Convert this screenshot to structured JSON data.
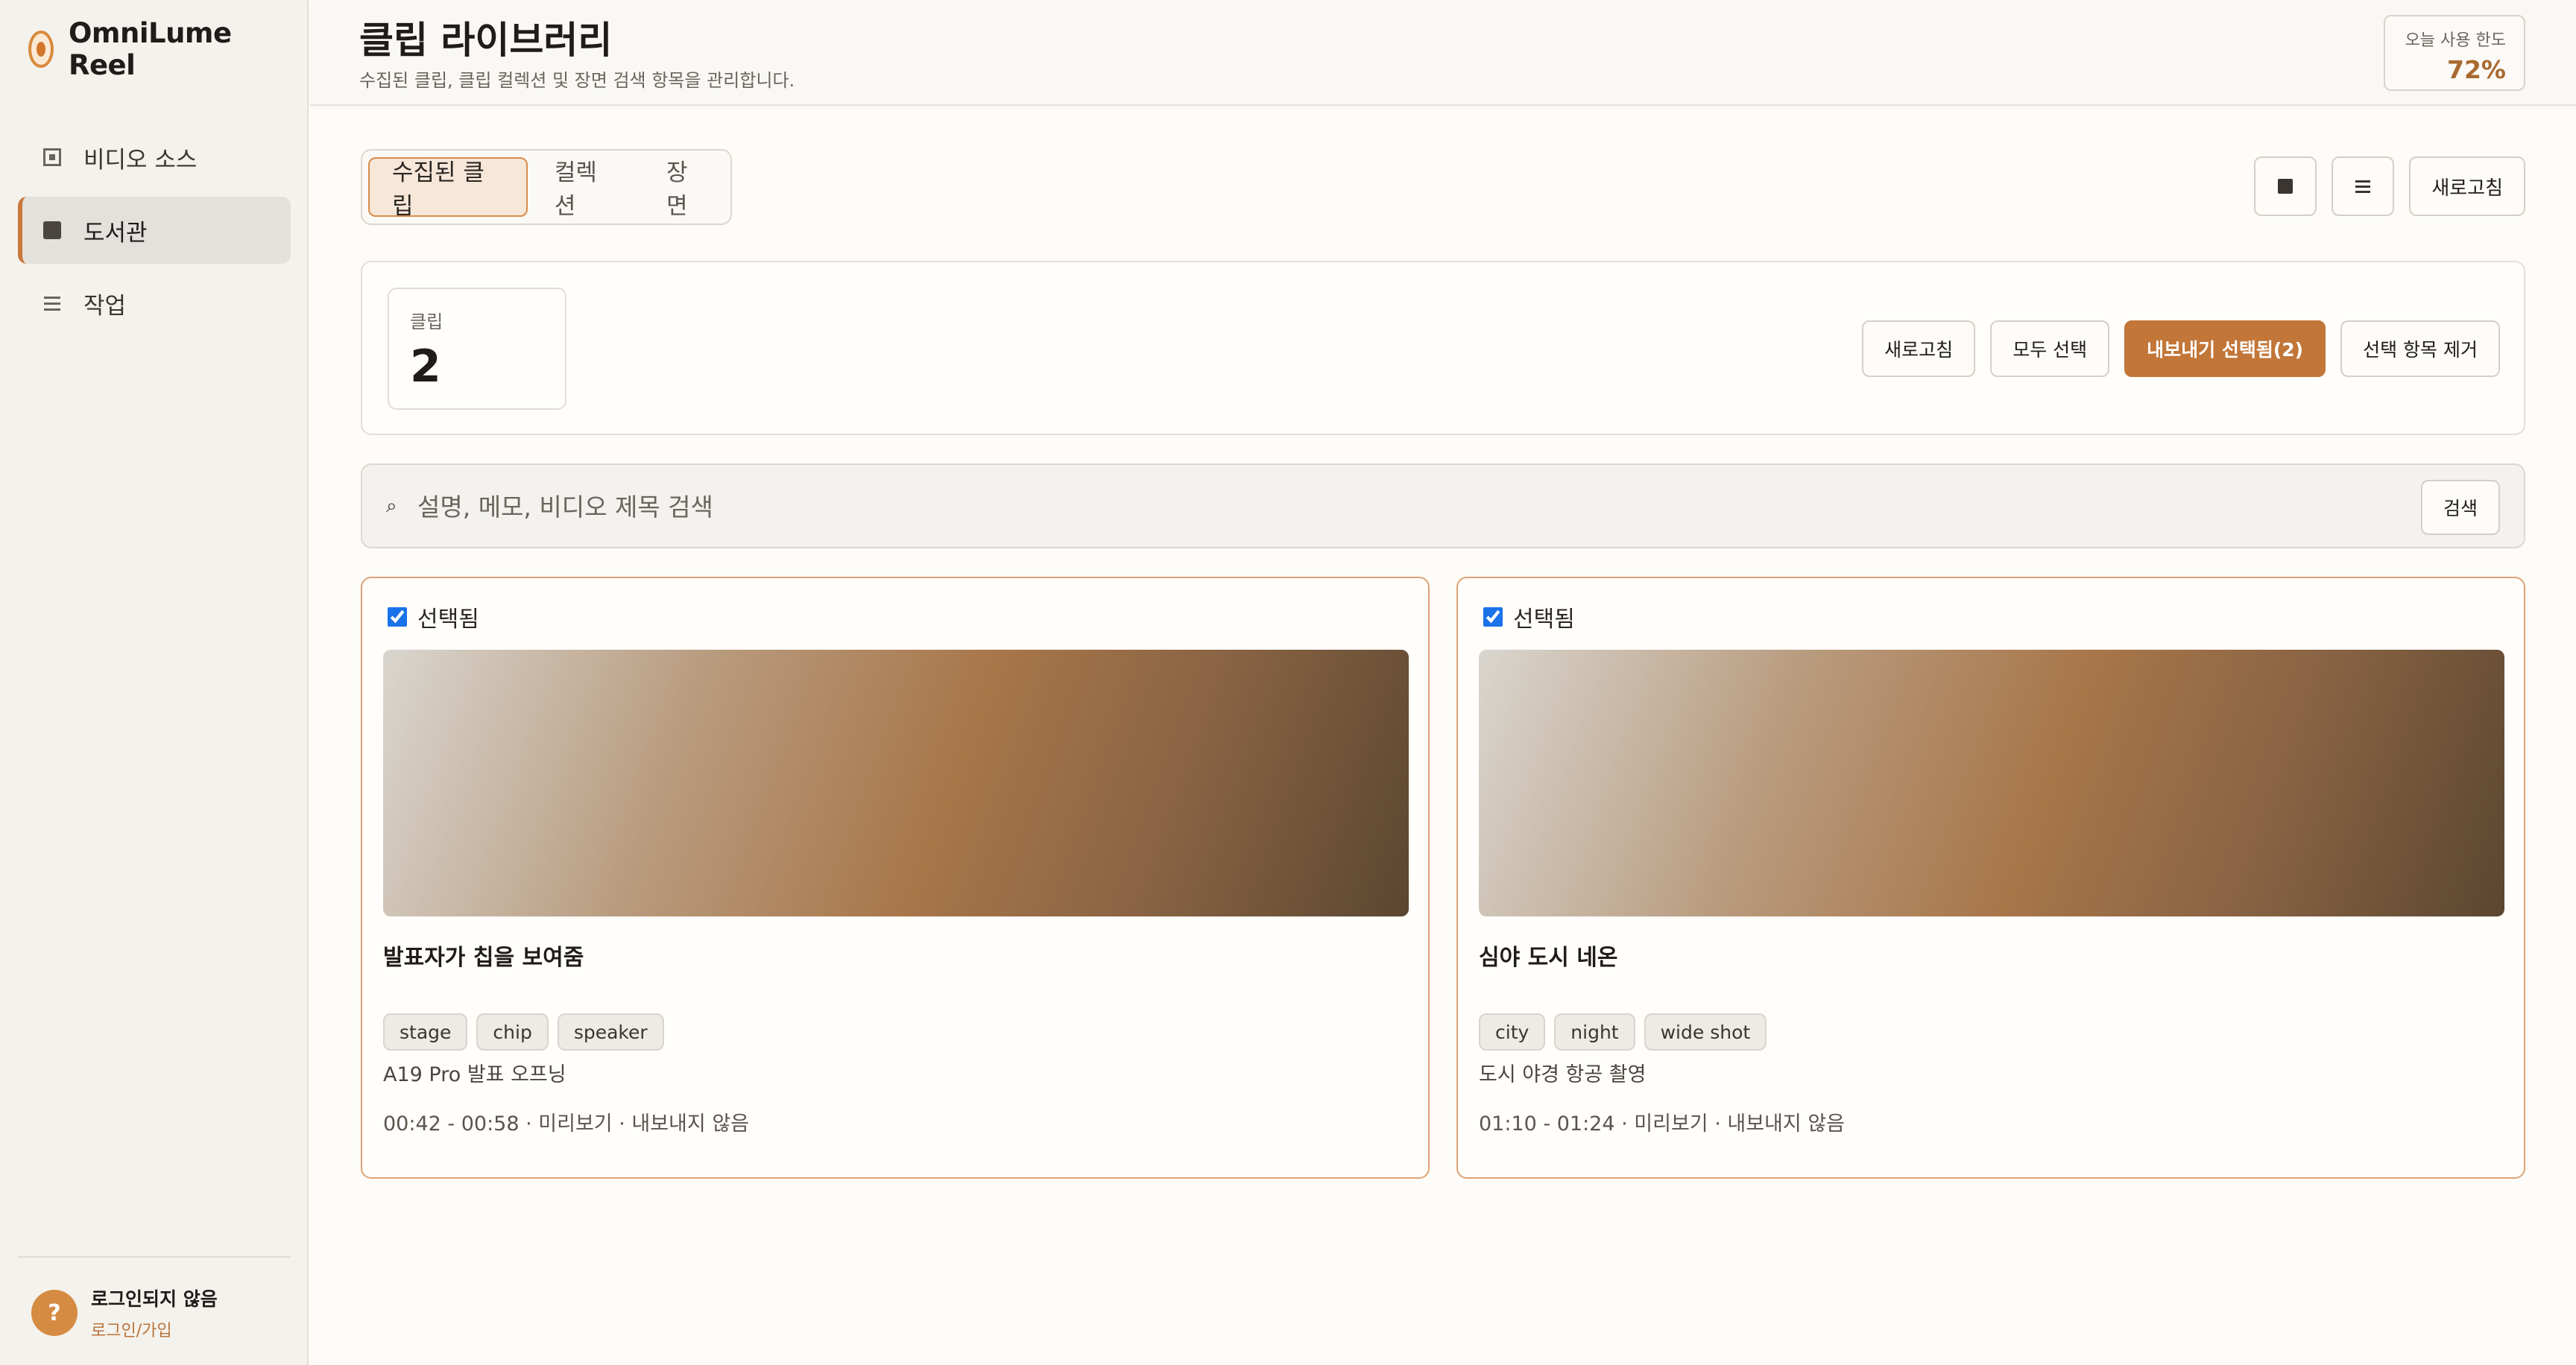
{
  "app": {
    "name": "OmniLume Reel"
  },
  "sidebar": {
    "items": [
      {
        "label": "비디오 소스",
        "icon": "video-source-icon",
        "active": false
      },
      {
        "label": "도서관",
        "icon": "library-icon",
        "active": true
      },
      {
        "label": "작업",
        "icon": "tasks-icon",
        "active": false
      }
    ],
    "user": {
      "avatar_glyph": "?",
      "status": "로그인되지 않음",
      "login_link": "로그인/가입"
    }
  },
  "header": {
    "title": "클립 라이브러리",
    "subtitle": "수집된 클립, 클립 컬렉션 및 장면 검색 항목을 관리합니다.",
    "quota_label": "오늘 사용 한도",
    "quota_value": "72%"
  },
  "tabs": [
    {
      "label": "수집된 클립",
      "active": true
    },
    {
      "label": "컬렉션",
      "active": false
    },
    {
      "label": "장면",
      "active": false
    }
  ],
  "toolbar": {
    "grid_icon": "grid-view-icon",
    "list_icon": "list-view-icon",
    "refresh_label": "새로고침"
  },
  "stats": {
    "label": "클립",
    "value": "2"
  },
  "actions": {
    "refresh": "새로고침",
    "select_all": "모두 선택",
    "export_selected": "내보내기 선택됨(2)",
    "remove_selected": "선택 항목 제거"
  },
  "search": {
    "icon": "search-icon",
    "placeholder": "설명, 메모, 비디오 제목 검색",
    "button": "검색"
  },
  "clips": [
    {
      "selected_label": "선택됨",
      "title": "발표자가 칩을 보여줌",
      "tags": [
        "stage",
        "chip",
        "speaker"
      ],
      "description": "A19 Pro 발표 오프닝",
      "meta": "00:42 - 00:58 · 미리보기 · 내보내지 않음"
    },
    {
      "selected_label": "선택됨",
      "title": "심야 도시 네온",
      "tags": [
        "city",
        "night",
        "wide shot"
      ],
      "description": "도시 야경 항공 촬영",
      "meta": "01:10 - 01:24 · 미리보기 · 내보내지 않음"
    }
  ],
  "colors": {
    "accent": "#c27638",
    "selected_border": "#dfa375",
    "sidebar_bg": "#f4f2ec"
  }
}
